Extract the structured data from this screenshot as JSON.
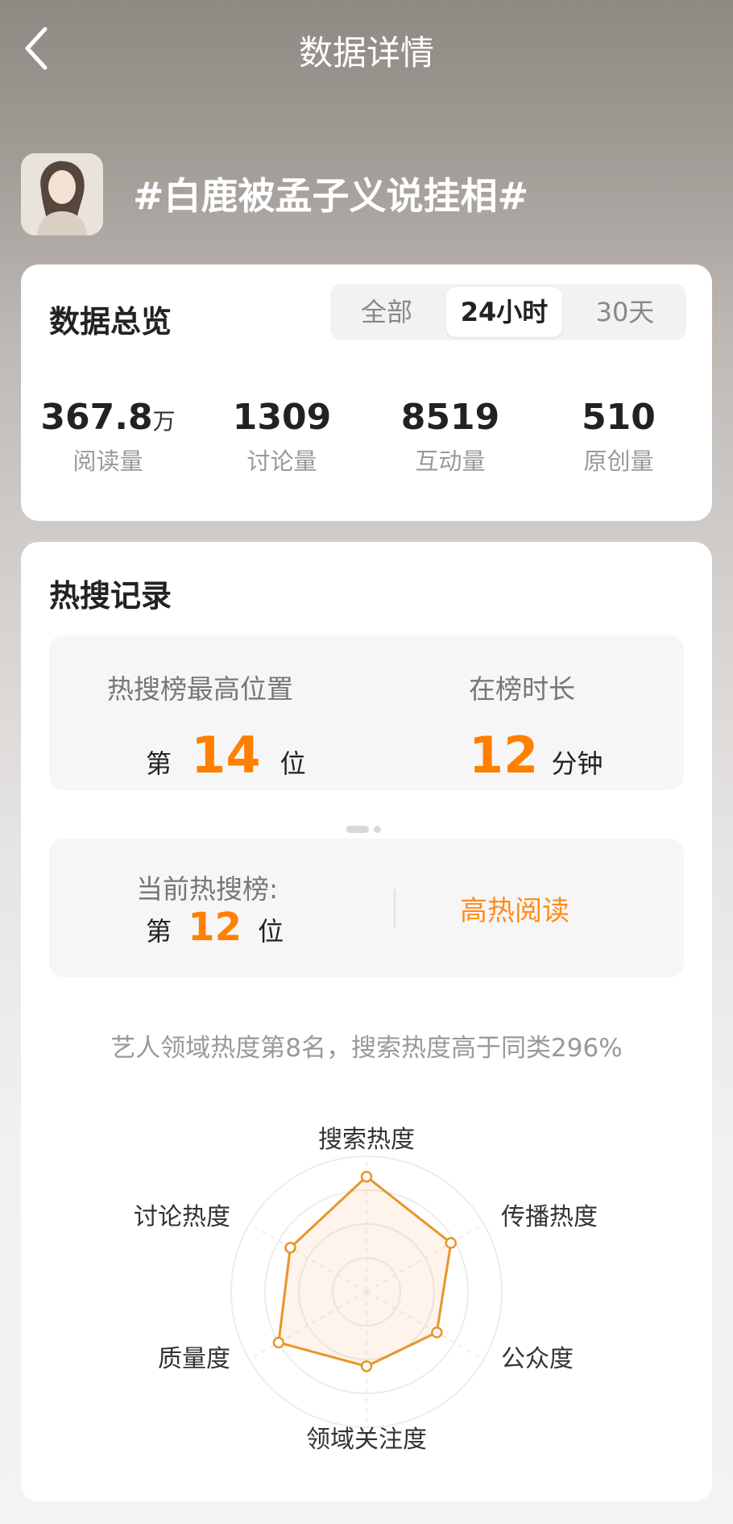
{
  "header": {
    "title": "数据详情"
  },
  "topic": {
    "title": "#白鹿被孟子义说挂相#"
  },
  "overview": {
    "title": "数据总览",
    "tabs": [
      {
        "label": "全部",
        "active": false
      },
      {
        "label": "24小时",
        "active": true
      },
      {
        "label": "30天",
        "active": false
      }
    ],
    "stats": [
      {
        "value": "367.8",
        "unit": "万",
        "label": "阅读量"
      },
      {
        "value": "1309",
        "unit": "",
        "label": "讨论量"
      },
      {
        "value": "8519",
        "unit": "",
        "label": "互动量"
      },
      {
        "value": "510",
        "unit": "",
        "label": "原创量"
      }
    ]
  },
  "hot_search": {
    "title": "热搜记录",
    "peak": {
      "label": "热搜榜最高位置",
      "prefix": "第",
      "value": "14",
      "suffix": "位"
    },
    "duration": {
      "label": "在榜时长",
      "value": "12",
      "unit": "分钟"
    },
    "current": {
      "label": "当前热搜榜:",
      "prefix": "第",
      "value": "12",
      "suffix": "位",
      "tag": "高热阅读"
    },
    "summary": "艺人领域热度第8名，搜索热度高于同类296%"
  },
  "radar": {
    "axes": [
      "搜索热度",
      "传播热度",
      "公众度",
      "领域关注度",
      "质量度",
      "讨论热度"
    ],
    "values": [
      0.85,
      0.72,
      0.6,
      0.55,
      0.75,
      0.65
    ],
    "color": "#e8952b"
  },
  "colors": {
    "accent": "#ff7f00"
  }
}
